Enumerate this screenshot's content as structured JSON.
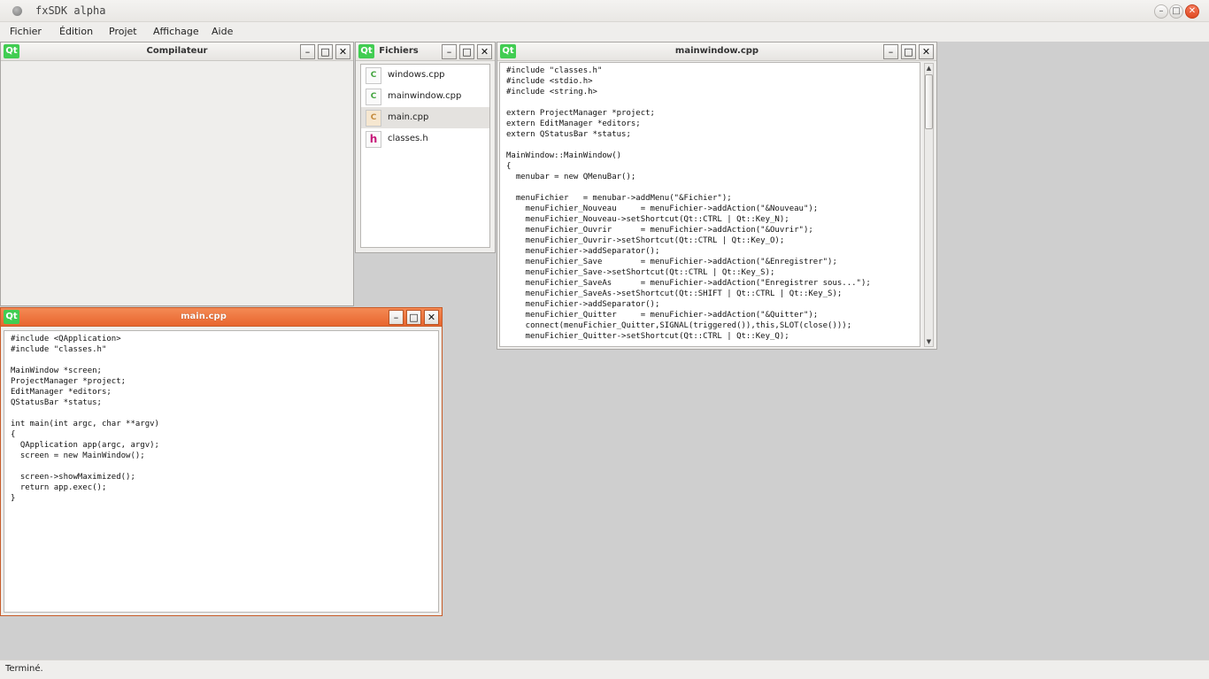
{
  "app": {
    "title": "fxSDK alpha",
    "wm_buttons": {
      "minimize": "–",
      "maximize": "□",
      "close": "✕"
    }
  },
  "menu": [
    "Fichier",
    "Édition",
    "Projet",
    "Affichage",
    "Aide"
  ],
  "windows": {
    "compiler": {
      "title": "Compilateur",
      "logo": "Qt"
    },
    "files": {
      "title": "Fichiers",
      "logo": "Qt",
      "items": [
        {
          "name": "windows.cpp",
          "icon_label": "C",
          "icon": "cpp-file-icon"
        },
        {
          "name": "mainwindow.cpp",
          "icon_label": "C",
          "icon": "cpp-file-icon"
        },
        {
          "name": "main.cpp",
          "icon_label": "C",
          "icon": "cpp-file-icon",
          "selected": true
        },
        {
          "name": "classes.h",
          "icon_label": "h",
          "icon": "header-file-icon"
        }
      ]
    },
    "mainwindow": {
      "title": "mainwindow.cpp",
      "logo": "Qt",
      "code": "#include \"classes.h\"\n#include <stdio.h>\n#include <string.h>\n\nextern ProjectManager *project;\nextern EditManager *editors;\nextern QStatusBar *status;\n\nMainWindow::MainWindow()\n{\n  menubar = new QMenuBar();\n\n  menuFichier   = menubar->addMenu(\"&Fichier\");\n    menuFichier_Nouveau     = menuFichier->addAction(\"&Nouveau\");\n    menuFichier_Nouveau->setShortcut(Qt::CTRL | Qt::Key_N);\n    menuFichier_Ouvrir      = menuFichier->addAction(\"&Ouvrir\");\n    menuFichier_Ouvrir->setShortcut(Qt::CTRL | Qt::Key_O);\n    menuFichier->addSeparator();\n    menuFichier_Save        = menuFichier->addAction(\"&Enregistrer\");\n    menuFichier_Save->setShortcut(Qt::CTRL | Qt::Key_S);\n    menuFichier_SaveAs      = menuFichier->addAction(\"Enregistrer sous...\");\n    menuFichier_SaveAs->setShortcut(Qt::SHIFT | Qt::CTRL | Qt::Key_S);\n    menuFichier->addSeparator();\n    menuFichier_Quitter     = menuFichier->addAction(\"&Quitter\");\n    connect(menuFichier_Quitter,SIGNAL(triggered()),this,SLOT(close()));\n    menuFichier_Quitter->setShortcut(Qt::CTRL | Qt::Key_Q);"
    },
    "main": {
      "title": "main.cpp",
      "logo": "Qt",
      "code": "#include <QApplication>\n#include \"classes.h\"\n\nMainWindow *screen;\nProjectManager *project;\nEditManager *editors;\nQStatusBar *status;\n\nint main(int argc, char **argv)\n{\n  QApplication app(argc, argv);\n  screen = new MainWindow();\n\n  screen->showMaximized();\n  return app.exec();\n}"
    }
  },
  "subwin_buttons": {
    "minimize": "–",
    "maximize": "□",
    "close": "✕"
  },
  "scroll_arrows": {
    "up": "▲",
    "down": "▼"
  },
  "status": {
    "text": "Terminé."
  },
  "colors": {
    "active_title": "#e8652e",
    "qt_green": "#41cd52",
    "workspace": "#cfcfcf"
  }
}
